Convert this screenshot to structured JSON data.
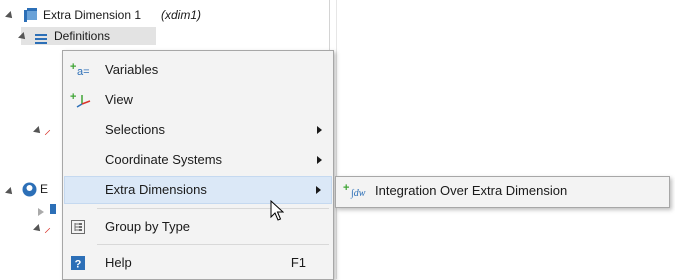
{
  "tree": {
    "root_label": "Extra Dimension 1",
    "root_tag": "(xdim1)",
    "child_label": "Definitions"
  },
  "menu": {
    "items": [
      {
        "label": "Variables",
        "icon": "variables-icon"
      },
      {
        "label": "View",
        "icon": "view-icon"
      },
      {
        "label": "Selections",
        "submenu": true
      },
      {
        "label": "Coordinate Systems",
        "submenu": true
      },
      {
        "label": "Extra Dimensions",
        "submenu": true,
        "highlighted": true
      },
      {
        "label": "Group by Type",
        "icon": "group-by-type-icon"
      },
      {
        "label": "Help",
        "icon": "help-icon",
        "shortcut": "F1"
      }
    ]
  },
  "submenu": {
    "items": [
      {
        "label": "Integration Over Extra Dimension",
        "icon": "integration-icon"
      }
    ]
  },
  "colors": {
    "highlight": "#dbe8f7",
    "menu_bg": "#f3f3f3",
    "accent_blue": "#2c6fb7",
    "plus_green": "#3fa535"
  }
}
